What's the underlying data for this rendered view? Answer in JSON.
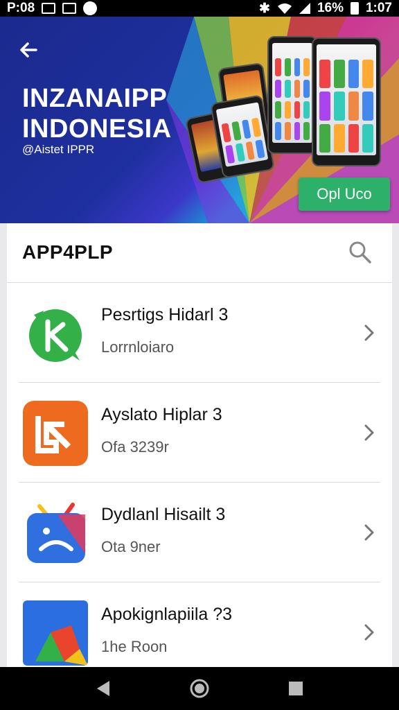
{
  "status_bar": {
    "left_text": "P:08",
    "battery_text": "16%",
    "time": "1:07"
  },
  "banner": {
    "title_line1": "INZANAIPP",
    "title_line2": "INDONESIA",
    "subtitle": "@Aistet IPPR",
    "open_button": "Opl Uco"
  },
  "search": {
    "title": "APP4PLP"
  },
  "apps": [
    {
      "title": "Pesrtigs Hidarl 3",
      "subtitle": "Lorrnloiaro"
    },
    {
      "title": "Ayslato Hiplar 3",
      "subtitle": "Ofa 3239r"
    },
    {
      "title": "Dydlanl Hisailt 3",
      "subtitle": "Ota 9ner"
    },
    {
      "title": "Apokignlapiila ?3",
      "subtitle": "1he Roon"
    }
  ],
  "colors": {
    "accent_green": "#2db06a",
    "banner_blue": "#1e2f9e"
  }
}
